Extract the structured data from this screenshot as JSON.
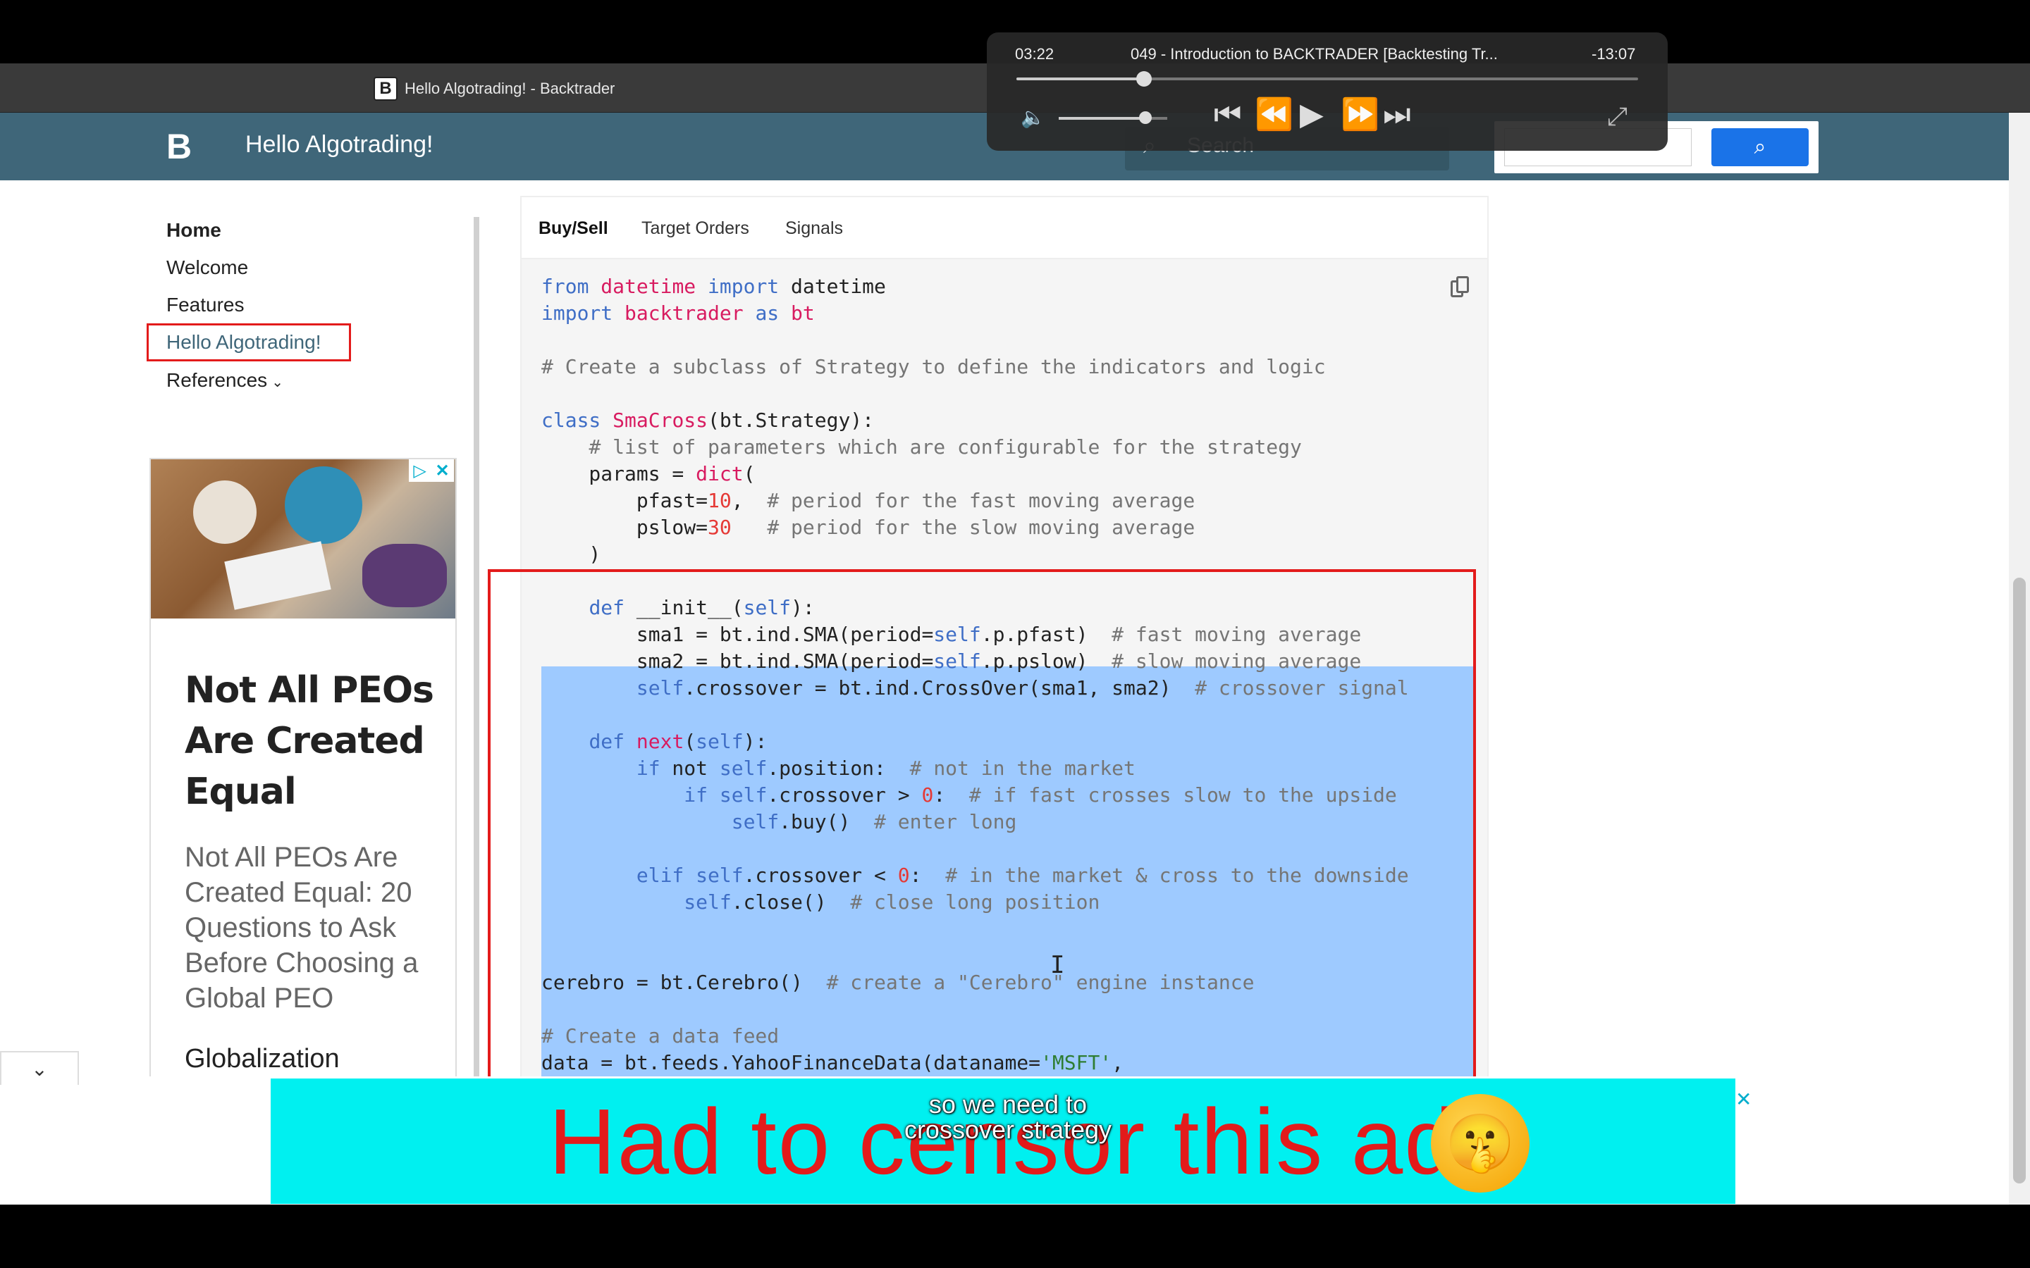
{
  "browser": {
    "tab_title": "Hello Algotrading! - Backtrader",
    "favicon_letter": "B"
  },
  "site": {
    "logo_glyph": "B",
    "title": "Hello Algotrading!",
    "search_placeholder": "Search"
  },
  "nav": {
    "items": [
      "Home",
      "Welcome",
      "Features",
      "Hello Algotrading!",
      "References"
    ],
    "active": "Hello Algotrading!"
  },
  "sidebar_ad": {
    "headline": "Not All PEOs Are Created Equal",
    "body": "Not All PEOs Are Created Equal: 20 Questions to Ask Before Choosing a Global PEO",
    "sub": "Globalization"
  },
  "code_tabs": {
    "items": [
      "Buy/Sell",
      "Target Orders",
      "Signals"
    ],
    "active": "Buy/Sell"
  },
  "code_lines": [
    "from datetime import datetime",
    "import backtrader as bt",
    "",
    "# Create a subclass of Strategy to define the indicators and logic",
    "",
    "class SmaCross(bt.Strategy):",
    "    # list of parameters which are configurable for the strategy",
    "    params = dict(",
    "        pfast=10,  # period for the fast moving average",
    "        pslow=30   # period for the slow moving average",
    "    )",
    "",
    "    def __init__(self):",
    "        sma1 = bt.ind.SMA(period=self.p.pfast)  # fast moving average",
    "        sma2 = bt.ind.SMA(period=self.p.pslow)  # slow moving average",
    "        self.crossover = bt.ind.CrossOver(sma1, sma2)  # crossover signal",
    "",
    "    def next(self):",
    "        if not self.position:  # not in the market",
    "            if self.crossover > 0:  # if fast crosses slow to the upside",
    "                self.buy()  # enter long",
    "",
    "        elif self.crossover < 0:  # in the market & cross to the downside",
    "            self.close()  # close long position",
    "",
    "",
    "cerebro = bt.Cerebro()  # create a \"Cerebro\" engine instance",
    "",
    "# Create a data feed",
    "data = bt.feeds.YahooFinanceData(dataname='MSFT',"
  ],
  "bottom_ad": {
    "censor_text": "Had to censor this ad",
    "emoji": "🤫"
  },
  "subtitle": {
    "line1": "so we need to",
    "line2": "crossover strategy"
  },
  "player": {
    "elapsed": "03:22",
    "title": "049 - Introduction to BACKTRADER [Backtesting Tr...",
    "remaining": "-13:07",
    "progress": 0.205,
    "volume": 0.8
  }
}
